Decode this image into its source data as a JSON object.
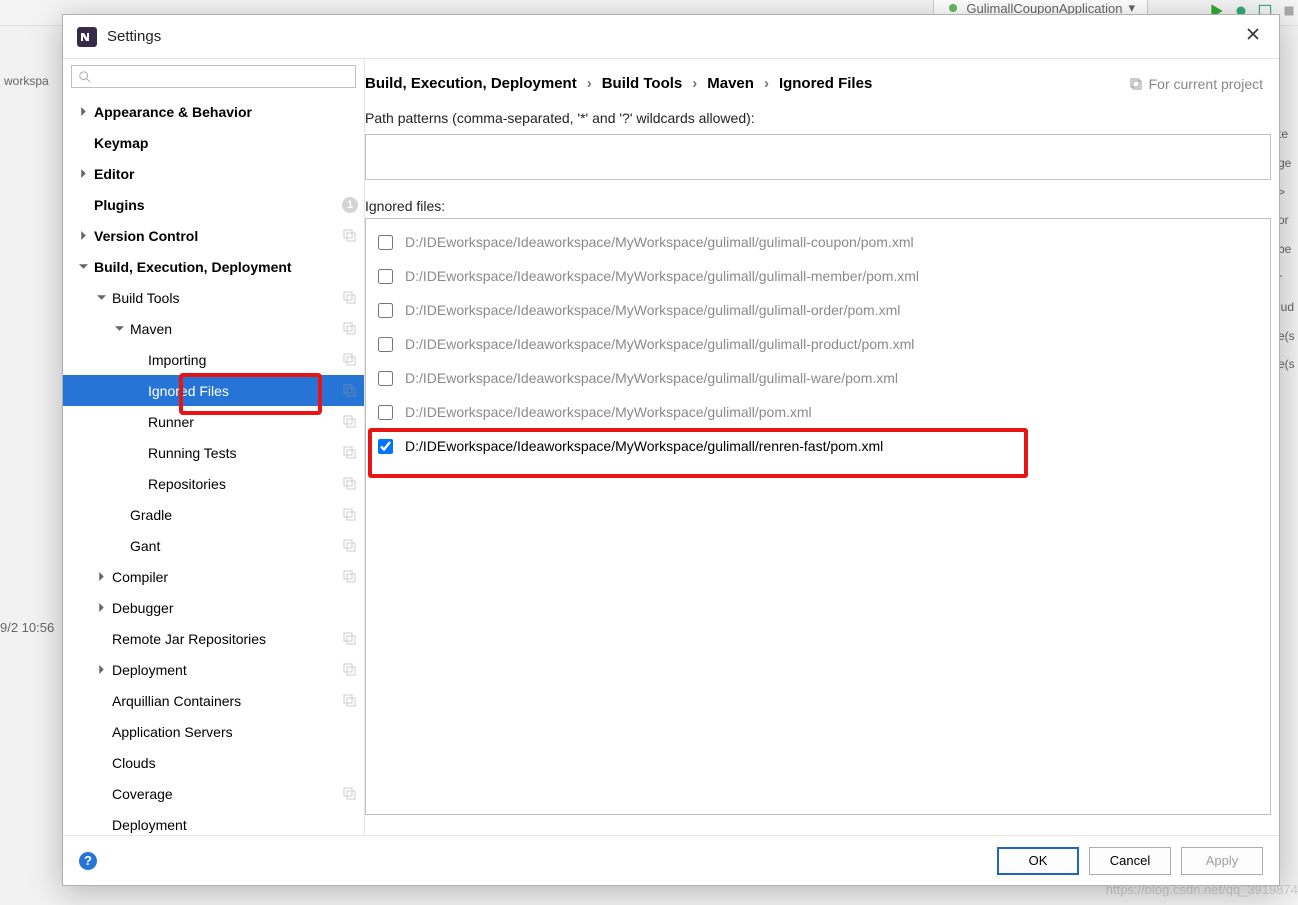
{
  "background": {
    "run_config": "GulimallCouponApplication",
    "left_label": "workspa",
    "timestamp": "9/2 10:56",
    "right_fragments": [
      "te",
      "ge",
      ">",
      "or",
      "be",
      "r",
      "lud",
      "e(s",
      "e(s"
    ],
    "watermark": "https://blog.csdn.net/qq_3919874"
  },
  "dialog": {
    "title": "Settings",
    "breadcrumb": [
      "Build, Execution, Deployment",
      "Build Tools",
      "Maven",
      "Ignored Files"
    ],
    "project_marker": "For current project",
    "search_placeholder": "",
    "tree": [
      {
        "label": "Appearance & Behavior",
        "indent": 0,
        "arrow": "right",
        "bold": true
      },
      {
        "label": "Keymap",
        "indent": 0,
        "arrow": "",
        "bold": true
      },
      {
        "label": "Editor",
        "indent": 0,
        "arrow": "right",
        "bold": true
      },
      {
        "label": "Plugins",
        "indent": 0,
        "arrow": "",
        "bold": true,
        "badge": "1"
      },
      {
        "label": "Version Control",
        "indent": 0,
        "arrow": "right",
        "bold": true,
        "trail": true
      },
      {
        "label": "Build, Execution, Deployment",
        "indent": 0,
        "arrow": "down",
        "bold": true
      },
      {
        "label": "Build Tools",
        "indent": 1,
        "arrow": "down",
        "bold": false,
        "trail": true
      },
      {
        "label": "Maven",
        "indent": 2,
        "arrow": "down",
        "bold": false,
        "trail": true
      },
      {
        "label": "Importing",
        "indent": 3,
        "arrow": "",
        "bold": false,
        "trail": true
      },
      {
        "label": "Ignored Files",
        "indent": 3,
        "arrow": "",
        "bold": false,
        "trail": true,
        "selected": true
      },
      {
        "label": "Runner",
        "indent": 3,
        "arrow": "",
        "bold": false,
        "trail": true
      },
      {
        "label": "Running Tests",
        "indent": 3,
        "arrow": "",
        "bold": false,
        "trail": true
      },
      {
        "label": "Repositories",
        "indent": 3,
        "arrow": "",
        "bold": false,
        "trail": true
      },
      {
        "label": "Gradle",
        "indent": 2,
        "arrow": "",
        "bold": false,
        "trail": true
      },
      {
        "label": "Gant",
        "indent": 2,
        "arrow": "",
        "bold": false,
        "trail": true
      },
      {
        "label": "Compiler",
        "indent": 1,
        "arrow": "right",
        "bold": false,
        "trail": true
      },
      {
        "label": "Debugger",
        "indent": 1,
        "arrow": "right",
        "bold": false
      },
      {
        "label": "Remote Jar Repositories",
        "indent": 1,
        "arrow": "",
        "bold": false,
        "trail": true
      },
      {
        "label": "Deployment",
        "indent": 1,
        "arrow": "right",
        "bold": false,
        "trail": true
      },
      {
        "label": "Arquillian Containers",
        "indent": 1,
        "arrow": "",
        "bold": false,
        "trail": true
      },
      {
        "label": "Application Servers",
        "indent": 1,
        "arrow": "",
        "bold": false
      },
      {
        "label": "Clouds",
        "indent": 1,
        "arrow": "",
        "bold": false
      },
      {
        "label": "Coverage",
        "indent": 1,
        "arrow": "",
        "bold": false,
        "trail": true
      },
      {
        "label": "Deployment",
        "indent": 1,
        "arrow": "",
        "bold": false
      }
    ],
    "patterns_label": "Path patterns (comma-separated, '*' and '?' wildcards allowed):",
    "patterns_value": "",
    "files_label": "Ignored files:",
    "files": [
      {
        "path": "D:/IDEworkspace/Ideaworkspace/MyWorkspace/gulimall/gulimall-coupon/pom.xml",
        "checked": false
      },
      {
        "path": "D:/IDEworkspace/Ideaworkspace/MyWorkspace/gulimall/gulimall-member/pom.xml",
        "checked": false
      },
      {
        "path": "D:/IDEworkspace/Ideaworkspace/MyWorkspace/gulimall/gulimall-order/pom.xml",
        "checked": false
      },
      {
        "path": "D:/IDEworkspace/Ideaworkspace/MyWorkspace/gulimall/gulimall-product/pom.xml",
        "checked": false
      },
      {
        "path": "D:/IDEworkspace/Ideaworkspace/MyWorkspace/gulimall/gulimall-ware/pom.xml",
        "checked": false
      },
      {
        "path": "D:/IDEworkspace/Ideaworkspace/MyWorkspace/gulimall/pom.xml",
        "checked": false
      },
      {
        "path": "D:/IDEworkspace/Ideaworkspace/MyWorkspace/gulimall/renren-fast/pom.xml",
        "checked": true
      }
    ],
    "buttons": {
      "ok": "OK",
      "cancel": "Cancel",
      "apply": "Apply"
    }
  }
}
